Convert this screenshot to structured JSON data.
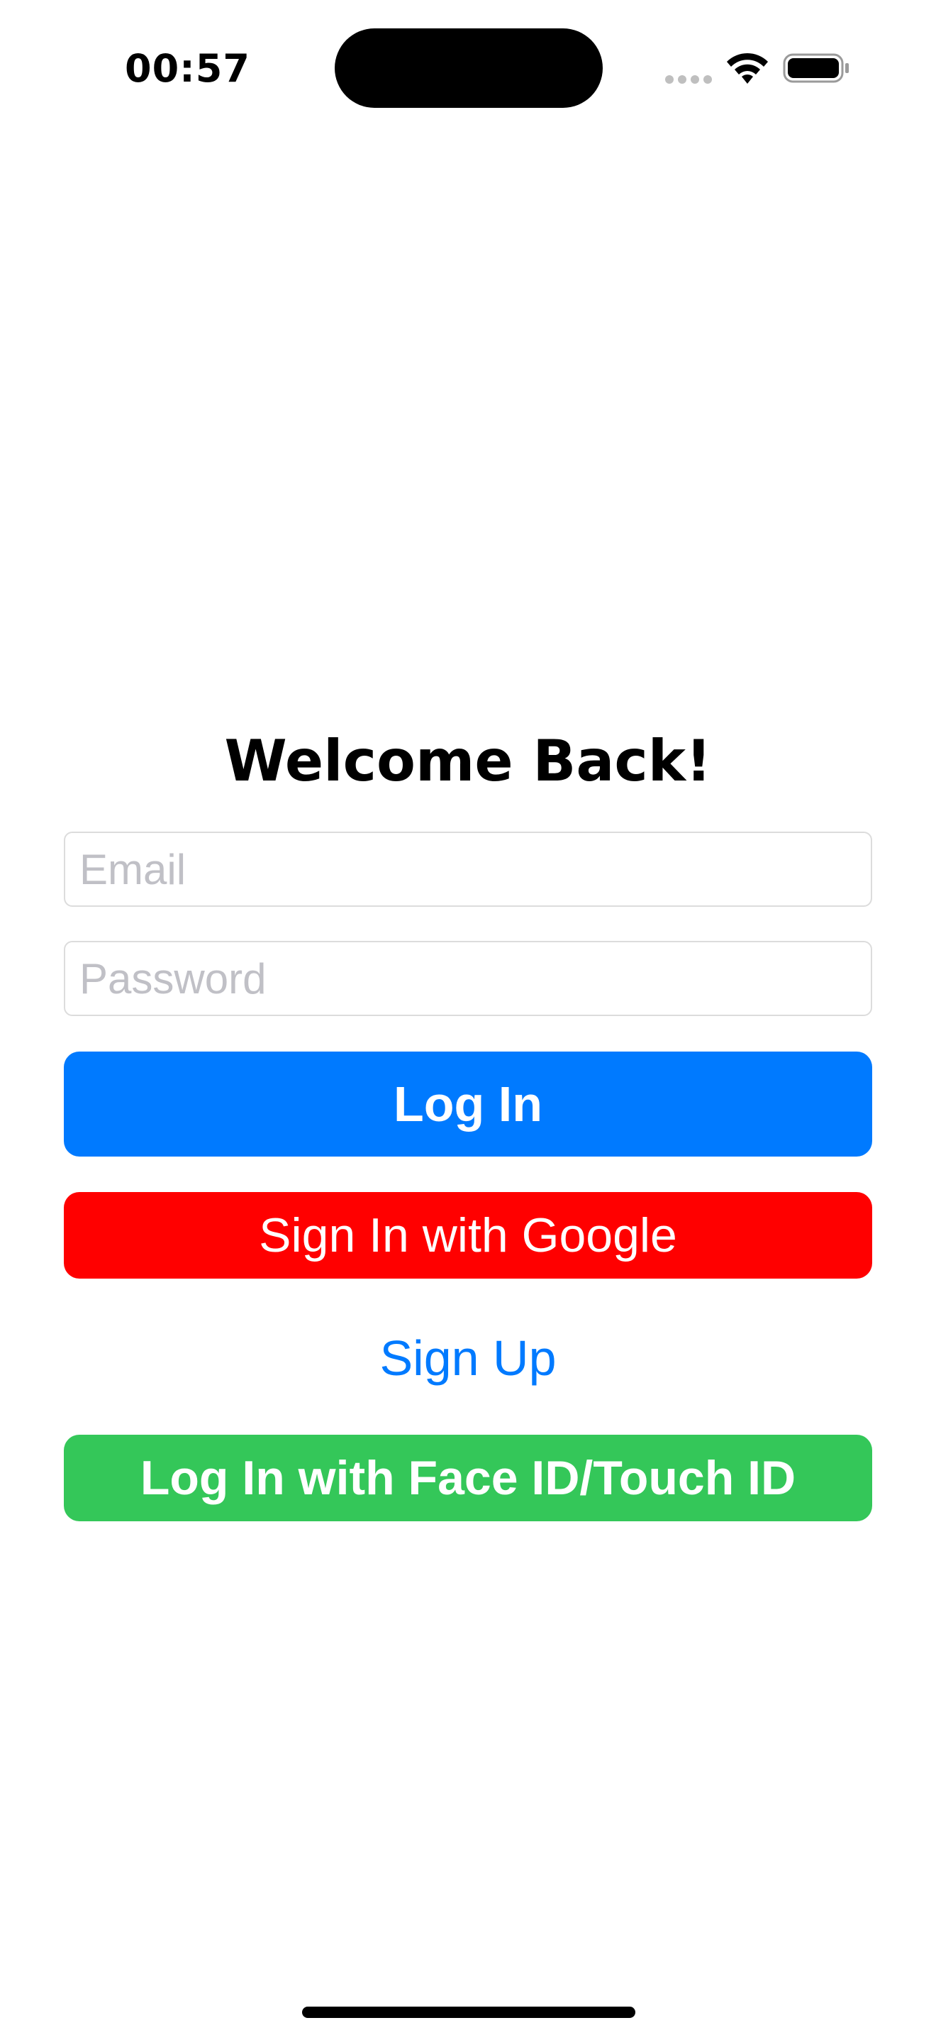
{
  "status_bar": {
    "time": "00:57",
    "wifi_icon": "wifi-icon",
    "battery_icon": "battery-icon",
    "signal_icon": "cellular-signal-icon"
  },
  "login": {
    "title": "Welcome Back!",
    "email_placeholder": "Email",
    "email_value": "",
    "password_placeholder": "Password",
    "password_value": "",
    "login_label": "Log In",
    "google_label": "Sign In with Google",
    "signup_label": "Sign Up",
    "faceid_label": "Log In with Face ID/Touch ID"
  },
  "colors": {
    "login_button": "#007aff",
    "google_button": "#ff0000",
    "signup_link": "#007aff",
    "faceid_button": "#34c759"
  }
}
